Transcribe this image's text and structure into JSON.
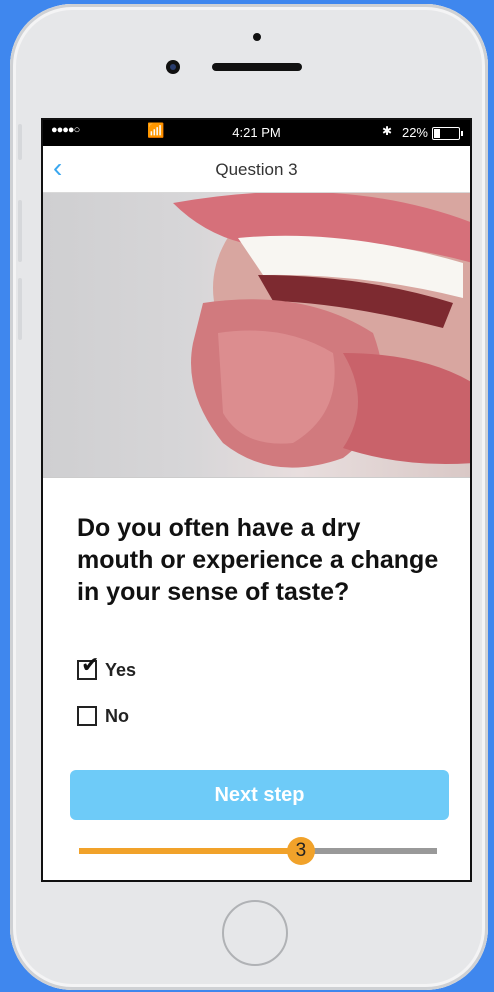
{
  "status_bar": {
    "signal": "●●●●○",
    "wifi_icon": "wifi-icon",
    "time": "4:21 PM",
    "bluetooth_icon": "bluetooth-icon",
    "battery_percent": "22%"
  },
  "nav": {
    "back_icon": "chevron-left-icon",
    "title": "Question 3"
  },
  "question": {
    "text": "Do you often have a dry mouth or experience a change in your sense of taste?"
  },
  "options": [
    {
      "label": "Yes",
      "checked": true
    },
    {
      "label": "No",
      "checked": false
    }
  ],
  "next_button": {
    "label": "Next step"
  },
  "progress": {
    "current_step": "3",
    "fraction": 0.62
  },
  "colors": {
    "background": "#3f87ee",
    "accent_blue": "#3aa7ef",
    "button": "#6ecbf8",
    "progress": "#f1a22a"
  }
}
